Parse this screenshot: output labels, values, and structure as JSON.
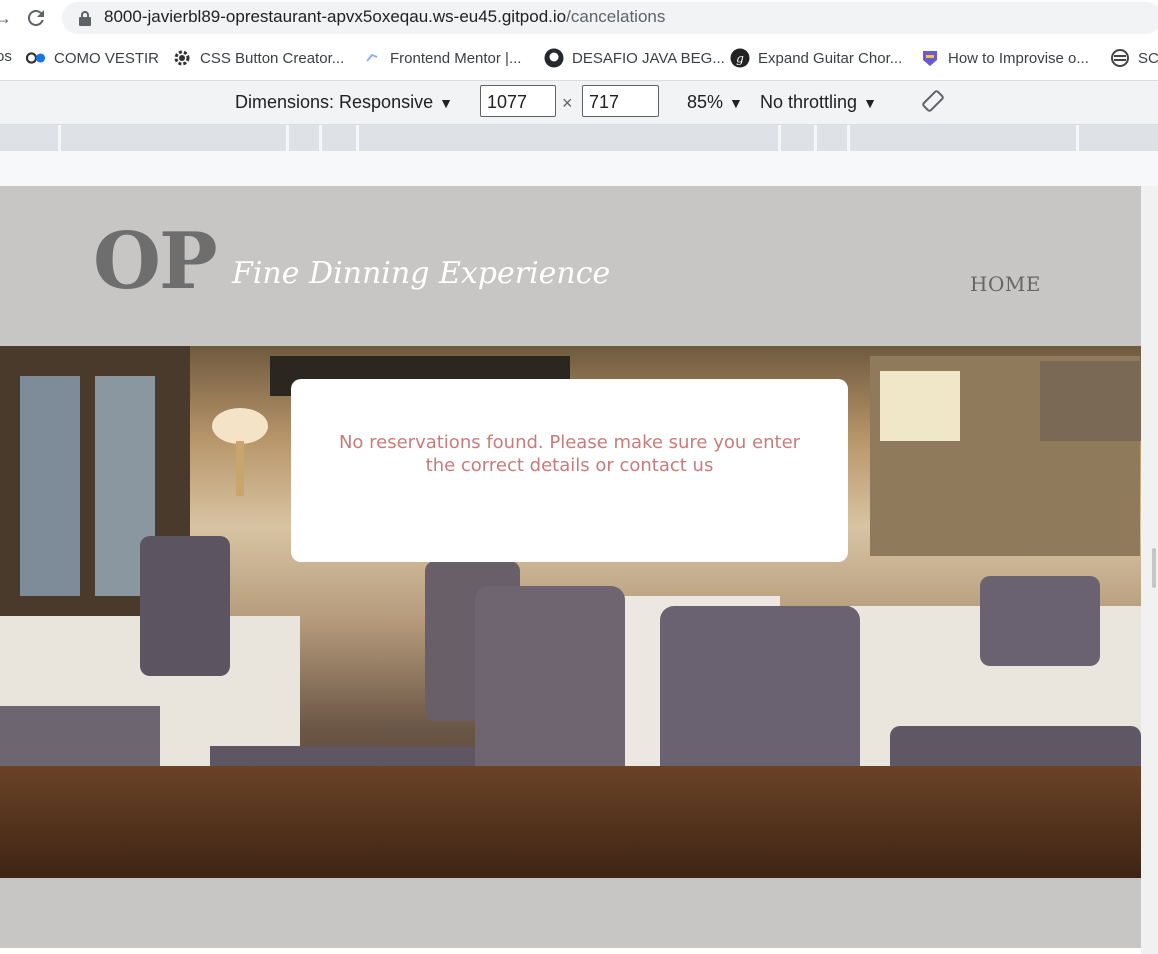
{
  "browser": {
    "url_host": "8000-javierbl89-oprestaurant-apvx5oxeqau.ws-eu45.gitpod.io",
    "url_path": "/cancelations",
    "bookmarks": [
      {
        "label": "os"
      },
      {
        "label": "COMO VESTIR"
      },
      {
        "label": "CSS Button Creator..."
      },
      {
        "label": "Frontend Mentor |..."
      },
      {
        "label": "DESAFIO JAVA BEG..."
      },
      {
        "label": "Expand Guitar Chor..."
      },
      {
        "label": "How to Improvise o..."
      },
      {
        "label": "SC"
      }
    ]
  },
  "devtools": {
    "dimensions_label": "Dimensions: Responsive",
    "width": "1077",
    "height": "717",
    "times": "×",
    "zoom": "85%",
    "throttling": "No throttling"
  },
  "site": {
    "logo": "OP",
    "tagline": "Fine Dinning Experience",
    "nav_home": "HOME",
    "message": "No reservations found. Please make sure you enter the correct details or contact us"
  }
}
